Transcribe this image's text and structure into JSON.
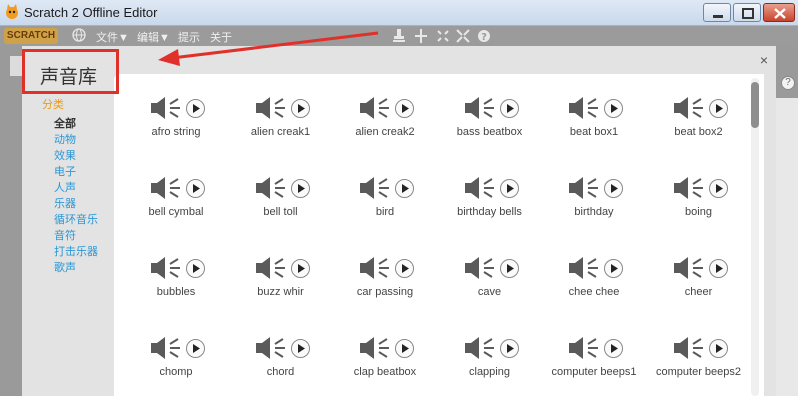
{
  "window": {
    "title": "Scratch 2 Offline Editor"
  },
  "menubar": {
    "logo": "SCRATCH",
    "items": [
      "文件▼",
      "编辑▼",
      "提示",
      "关于"
    ]
  },
  "dialog": {
    "title": "声音库",
    "close": "×",
    "category_header": "分类",
    "categories": [
      "全部",
      "动物",
      "效果",
      "电子",
      "人声",
      "乐器",
      "循环音乐",
      "音符",
      "打击乐器",
      "歌声"
    ],
    "selected_category": "全部",
    "sounds": [
      "afro string",
      "alien creak1",
      "alien creak2",
      "bass beatbox",
      "beat box1",
      "beat box2",
      "bell cymbal",
      "bell toll",
      "bird",
      "birthday bells",
      "birthday",
      "boing",
      "bubbles",
      "buzz whir",
      "car passing",
      "cave",
      "chee chee",
      "cheer",
      "chomp",
      "chord",
      "clap beatbox",
      "clapping",
      "computer beeps1",
      "computer beeps2"
    ]
  },
  "colors": {
    "accent_category": "#2a97d6",
    "category_header": "#e89c16",
    "annotation_red": "#e0302a"
  }
}
